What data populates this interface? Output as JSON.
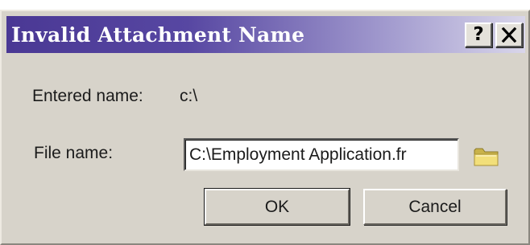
{
  "window": {
    "title": "Invalid Attachment Name",
    "help_button_label": "?",
    "close_button_icon": "close-x"
  },
  "form": {
    "entered_name_label": "Entered name:",
    "entered_name_value": "c:\\",
    "file_name_label": "File name:",
    "file_name_value": "C:\\Employment Application.fr",
    "browse_icon": "folder"
  },
  "buttons": {
    "ok_label": "OK",
    "cancel_label": "Cancel"
  },
  "colors": {
    "titlebar_start": "#4a3894",
    "titlebar_end": "#d9d6ea",
    "dialog_face": "#d7d3ca",
    "folder_icon": "#f2df7a"
  }
}
